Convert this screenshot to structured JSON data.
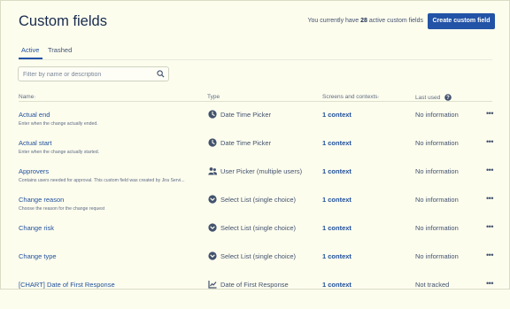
{
  "page": {
    "title": "Custom fields",
    "count_prefix": "You currently have",
    "count_value": "28",
    "count_suffix": "active custom fields",
    "create_button": "Create custom field"
  },
  "tabs": [
    {
      "label": "Active",
      "active": true
    },
    {
      "label": "Trashed",
      "active": false
    }
  ],
  "search": {
    "placeholder": "Filter by name or description",
    "value": ""
  },
  "columns": {
    "name": "Name",
    "name_sort": "↑",
    "type": "Type",
    "screens": "Screens and contexts",
    "screens_sort": "↑",
    "last_used": "Last used"
  },
  "rows": [
    {
      "name": "Actual end",
      "description": "Enter when the change actually ended.",
      "type_icon": "clock-icon",
      "type": "Date Time Picker",
      "context": "1 context",
      "last_used": "No information",
      "more": "•••"
    },
    {
      "name": "Actual start",
      "description": "Enter when the change actually started.",
      "type_icon": "clock-icon",
      "type": "Date Time Picker",
      "context": "1 context",
      "last_used": "No information",
      "more": "•••"
    },
    {
      "name": "Approvers",
      "description": "Contains users needed for approval. This custom field was created by Jira Servi...",
      "type_icon": "users-icon",
      "type": "User Picker (multiple users)",
      "context": "1 context",
      "last_used": "No information",
      "more": "•••"
    },
    {
      "name": "Change reason",
      "description": "Choose the reason for the change request",
      "type_icon": "chevron-down-circle-icon",
      "type": "Select List (single choice)",
      "context": "1 context",
      "last_used": "No information",
      "more": "•••"
    },
    {
      "name": "Change risk",
      "description": "",
      "type_icon": "chevron-down-circle-icon",
      "type": "Select List (single choice)",
      "context": "1 context",
      "last_used": "No information",
      "more": "•••"
    },
    {
      "name": "Change type",
      "description": "",
      "type_icon": "chevron-down-circle-icon",
      "type": "Select List (single choice)",
      "context": "1 context",
      "last_used": "No information",
      "more": "•••"
    },
    {
      "name": "[CHART] Date of First Response",
      "description": "",
      "type_icon": "chart-line-icon",
      "type": "Date of First Response",
      "context": "1 context",
      "last_used": "Not tracked",
      "more": "•••"
    }
  ]
}
